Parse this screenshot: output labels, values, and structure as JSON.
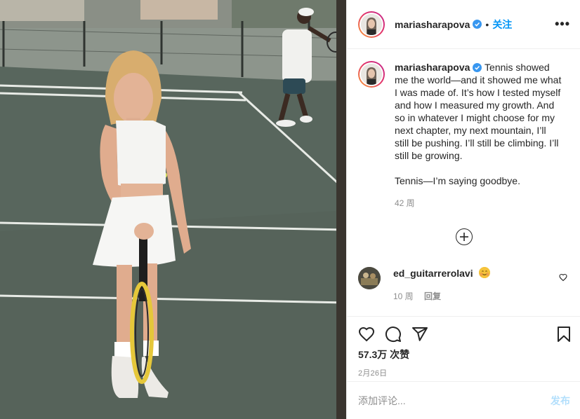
{
  "post": {
    "username": "mariasharapova",
    "follow_label": "关注",
    "separator": "•",
    "more_label": "•••",
    "caption_p1": "Tennis showed me the world—and it showed me what I was made of. It’s how I tested myself and how I measured my growth. And so in whatever I might choose for my next chapter, my next mountain, I’ll still be pushing. I’ll still be climbing. I’ll still be growing.",
    "caption_p2": "Tennis—I’m saying goodbye.",
    "caption_time": "42 周",
    "likes": "57.3万 次赞",
    "date": "2月26日"
  },
  "comments": [
    {
      "username": "ed_guitarrerolavi",
      "time": "10 周",
      "reply_label": "回复"
    }
  ],
  "comment_box": {
    "placeholder": "添加评论...",
    "post_label": "发布"
  },
  "colors": {
    "accent": "#0095f6",
    "post_disabled": "#b2dffc",
    "muted": "#8e8e8e",
    "border": "#efefef"
  },
  "icons": {
    "more": "more-icon",
    "verified": "verified-badge-icon",
    "load_more": "plus-circle-icon",
    "like": "heart-icon",
    "comment": "comment-bubble-icon",
    "share": "paper-plane-icon",
    "save": "bookmark-icon",
    "emoji": "smiling-face-emoji"
  }
}
